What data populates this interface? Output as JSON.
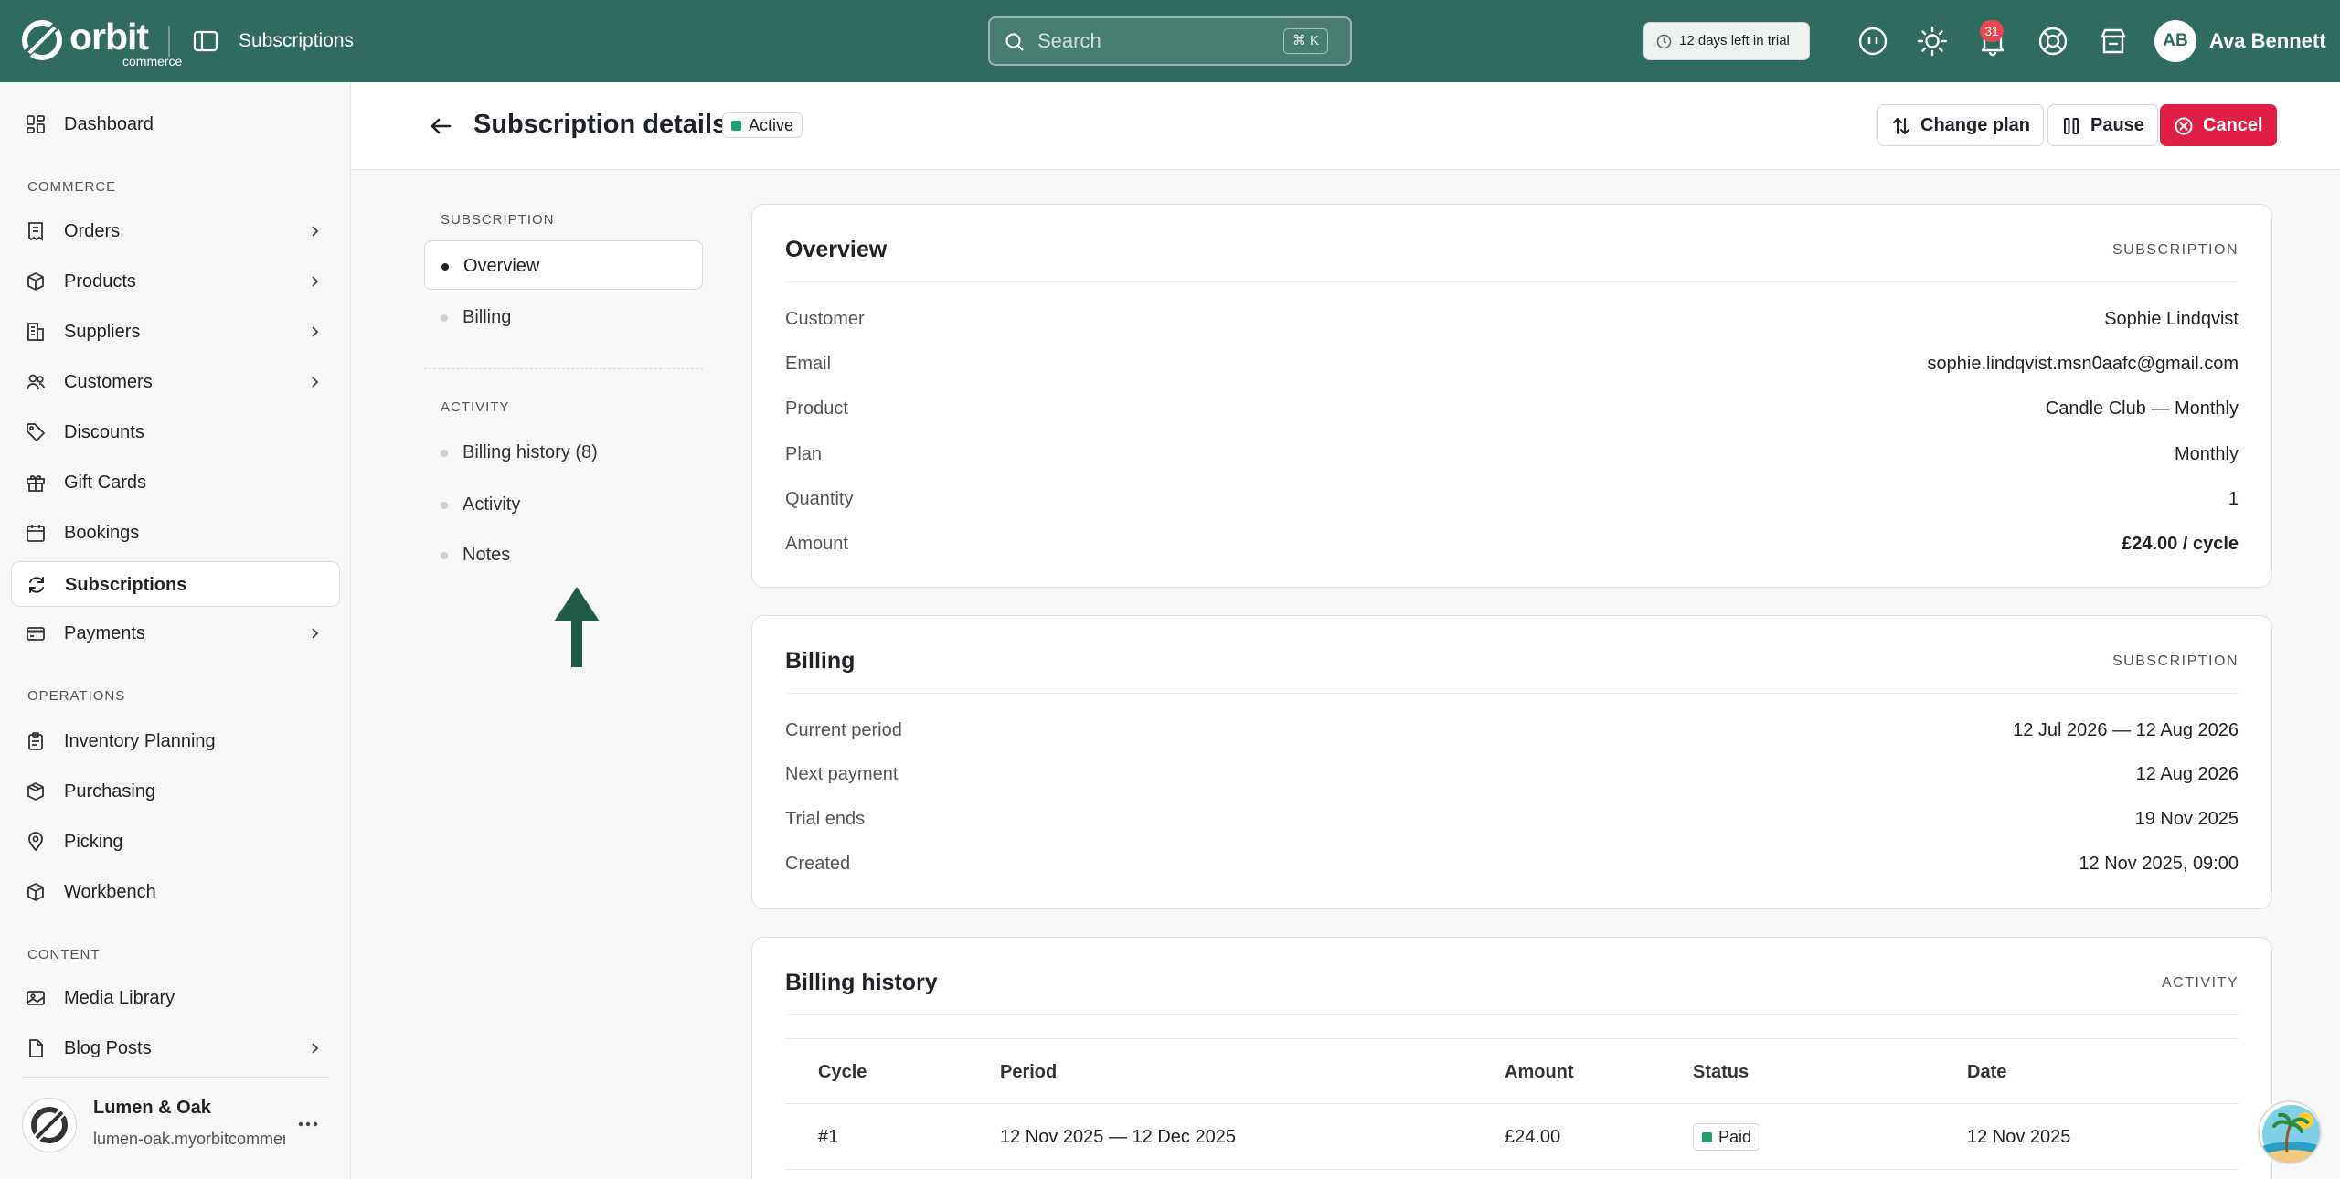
{
  "topbar": {
    "brand": "orbit",
    "brand_sub": "commerce",
    "section_title": "Subscriptions",
    "search_placeholder": "Search",
    "search_shortcut": "⌘ K",
    "trial_text": "12 days left in trial",
    "notifications_count": "31",
    "user_initials": "AB",
    "user_name": "Ava Bennett",
    "accent_color": "#2f6b5e"
  },
  "sidebar": {
    "dashboard": "Dashboard",
    "section_commerce": "COMMERCE",
    "section_operations": "OPERATIONS",
    "section_content": "CONTENT",
    "items": {
      "orders": "Orders",
      "products": "Products",
      "suppliers": "Suppliers",
      "customers": "Customers",
      "discounts": "Discounts",
      "gift_cards": "Gift Cards",
      "bookings": "Bookings",
      "subscriptions": "Subscriptions",
      "payments": "Payments",
      "inventory_planning": "Inventory Planning",
      "purchasing": "Purchasing",
      "picking": "Picking",
      "workbench": "Workbench",
      "media_library": "Media Library",
      "blog_posts": "Blog Posts"
    },
    "active_item": "Subscriptions",
    "store_name": "Lumen & Oak",
    "store_url": "lumen-oak.myorbitcommerce.com"
  },
  "header": {
    "title": "Subscription details",
    "status": "Active",
    "status_color": "#22a06b",
    "change_plan": "Change plan",
    "pause": "Pause",
    "cancel": "Cancel",
    "cancel_color": "#e11d48"
  },
  "section_nav": {
    "subscription_label": "SUBSCRIPTION",
    "activity_label": "ACTIVITY",
    "overview": "Overview",
    "billing": "Billing",
    "billing_history": "Billing history (8)",
    "activity": "Activity",
    "notes": "Notes"
  },
  "overview": {
    "title": "Overview",
    "tag": "SUBSCRIPTION",
    "rows": [
      {
        "key": "Customer",
        "value": "Sophie Lindqvist"
      },
      {
        "key": "Email",
        "value": "sophie.lindqvist.msn0aafc@gmail.com"
      },
      {
        "key": "Product",
        "value": "Candle Club — Monthly"
      },
      {
        "key": "Plan",
        "value": "Monthly"
      },
      {
        "key": "Quantity",
        "value": "1"
      },
      {
        "key": "Amount",
        "value": "£24.00 / cycle"
      }
    ]
  },
  "billing": {
    "title": "Billing",
    "tag": "SUBSCRIPTION",
    "rows": [
      {
        "key": "Current period",
        "value": "12 Jul 2026 — 12 Aug 2026"
      },
      {
        "key": "Next payment",
        "value": "12 Aug 2026"
      },
      {
        "key": "Trial ends",
        "value": "19 Nov 2025"
      },
      {
        "key": "Created",
        "value": "12 Nov 2025, 09:00"
      }
    ]
  },
  "billing_history": {
    "title": "Billing history",
    "tag": "ACTIVITY",
    "columns": [
      "Cycle",
      "Period",
      "Amount",
      "Status",
      "Date"
    ],
    "rows": [
      {
        "cycle": "#1",
        "period": "12 Nov 2025 — 12 Dec 2025",
        "amount": "£24.00",
        "status": "Paid",
        "date": "12 Nov 2025"
      }
    ]
  }
}
